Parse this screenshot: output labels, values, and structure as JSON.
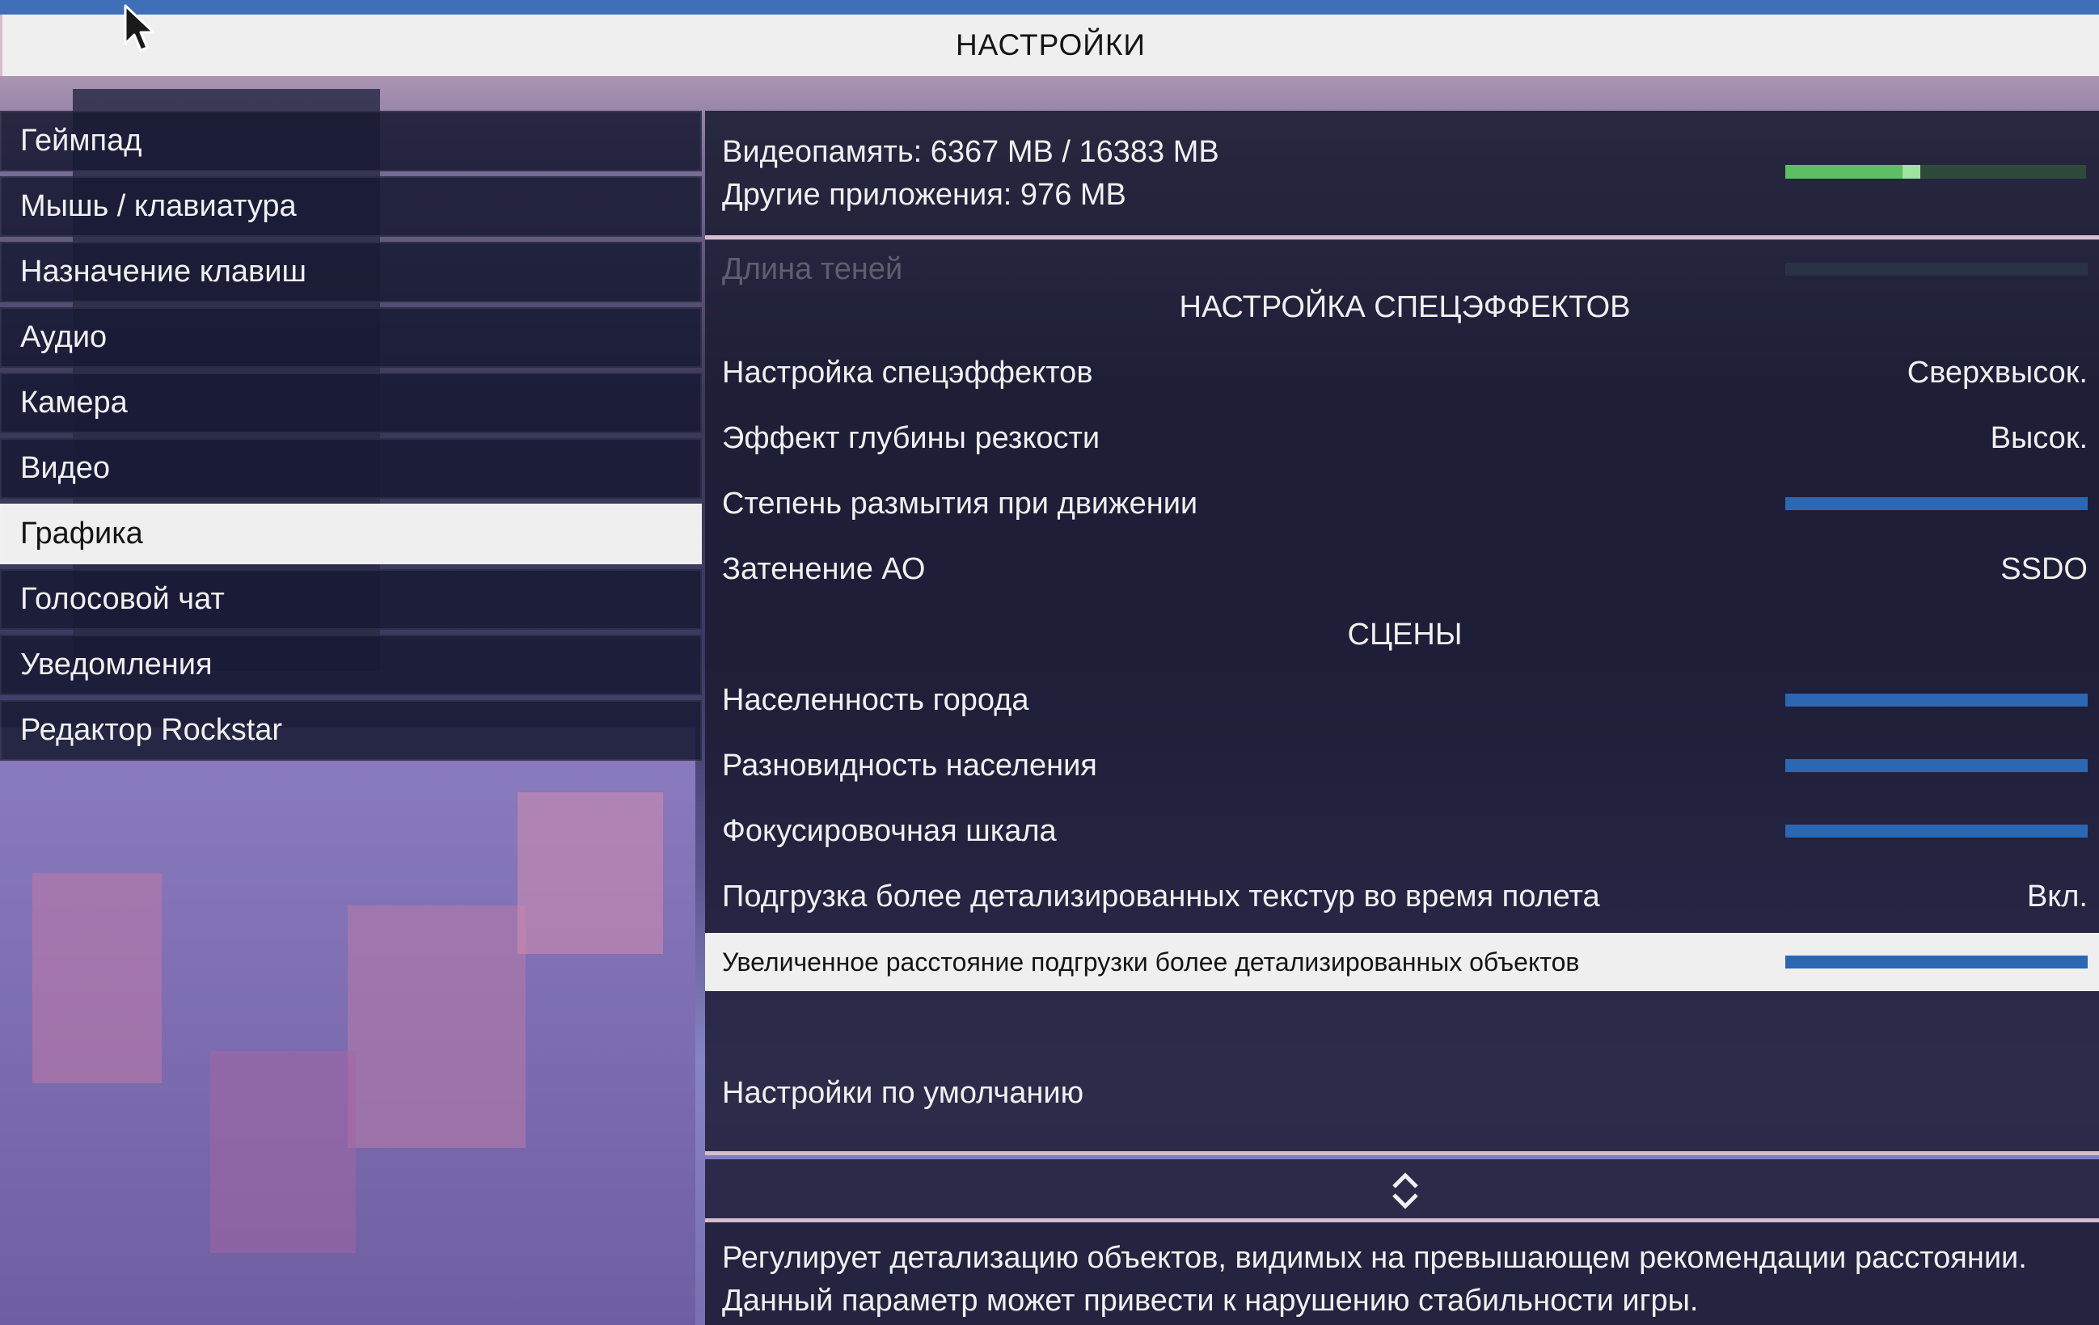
{
  "title": "НАСТРОЙКИ",
  "menu": {
    "items": [
      {
        "label": "Геймпад"
      },
      {
        "label": "Мышь / клавиатура"
      },
      {
        "label": "Назначение клавиш"
      },
      {
        "label": "Аудио"
      },
      {
        "label": "Камера"
      },
      {
        "label": "Видео"
      },
      {
        "label": "Графика",
        "active": true
      },
      {
        "label": "Голосовой чат"
      },
      {
        "label": "Уведомления"
      },
      {
        "label": "Редактор Rockstar"
      }
    ]
  },
  "vram": {
    "line1": "Видеопамять: 6367 MB / 16383 MB",
    "line2": "Другие приложения: 976 MB",
    "used_fraction": 0.389,
    "other_fraction": 0.06,
    "colors": {
      "used": "#5fbf64",
      "other": "#9ee39e",
      "track": "#2f4a3c"
    }
  },
  "settings": {
    "shadow_length": {
      "label": "Длина теней",
      "disabled": true
    },
    "section_effects": "НАСТРОЙКА СПЕЦЭФФЕКТОВ",
    "effects_quality": {
      "label": "Настройка спецэффектов",
      "value": "Сверхвысок."
    },
    "depth_of_field": {
      "label": "Эффект глубины резкости",
      "value": "Высок."
    },
    "motion_blur": {
      "label": "Степень размытия при движении",
      "level": 1.0
    },
    "ambient_occlusion": {
      "label": "Затенение АО",
      "value": "SSDO"
    },
    "section_scenes": "СЦЕНЫ",
    "population_density": {
      "label": "Населенность города",
      "level": 1.0
    },
    "population_variety": {
      "label": "Разновидность населения",
      "level": 1.0
    },
    "distance_scaling": {
      "label": "Фокусировочная шкала",
      "level": 1.0
    },
    "hd_flight": {
      "label": "Подгрузка более детализированных текстур во время полета",
      "value": "Вкл."
    },
    "extended_distance": {
      "label": "Увеличенное расстояние подгрузки более детализированных объектов",
      "level": 1.0,
      "selected": true
    },
    "restore_defaults": "Настройки по умолчанию"
  },
  "scroll_icon": "up-down-chevron-icon",
  "description": "Регулирует детализацию объектов, видимых на превышающем рекомендации расстоянии. Данный параметр может привести к нарушению стабильности игры.",
  "colors": {
    "accent": "#3e6fb8",
    "bar": "#2c67b4",
    "selected_bg": "#efefef"
  }
}
